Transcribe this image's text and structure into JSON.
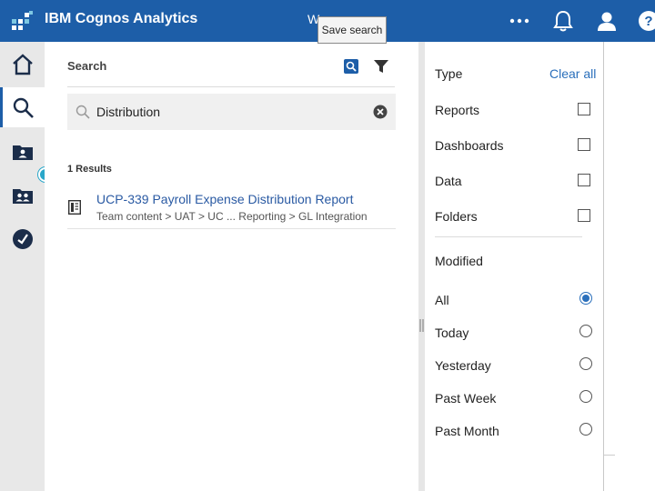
{
  "header": {
    "app_title": "IBM Cognos Analytics",
    "welcome_text": "W",
    "icons": [
      "app-grid-icon",
      "more-icon",
      "bell-icon",
      "user-icon",
      "help-icon"
    ],
    "help_glyph": "?"
  },
  "tooltip": {
    "text": "Save search"
  },
  "rail": {
    "items": [
      "home-icon",
      "search-icon",
      "my-content-icon",
      "team-content-icon",
      "recent-icon"
    ]
  },
  "search_panel": {
    "title": "Search",
    "query": "Distribution",
    "results_count": "1 Results",
    "results": [
      {
        "title": "UCP-339 Payroll Expense Distribution Report",
        "path": "Team content > UAT > UC ... Reporting > GL Integration"
      }
    ]
  },
  "filter_panel": {
    "type_heading": "Type",
    "clear_all": "Clear all",
    "types": [
      {
        "label": "Reports",
        "checked": false
      },
      {
        "label": "Dashboards",
        "checked": false
      },
      {
        "label": "Data",
        "checked": false
      },
      {
        "label": "Folders",
        "checked": false
      }
    ],
    "modified_heading": "Modified",
    "modified_options": [
      {
        "label": "All",
        "selected": true
      },
      {
        "label": "Today",
        "selected": false
      },
      {
        "label": "Yesterday",
        "selected": false
      },
      {
        "label": "Past Week",
        "selected": false
      },
      {
        "label": "Past Month",
        "selected": false
      }
    ]
  },
  "colors": {
    "brand": "#1d5ea8",
    "link": "#2a5aa3",
    "accent_dot": "#2aa7c9"
  }
}
